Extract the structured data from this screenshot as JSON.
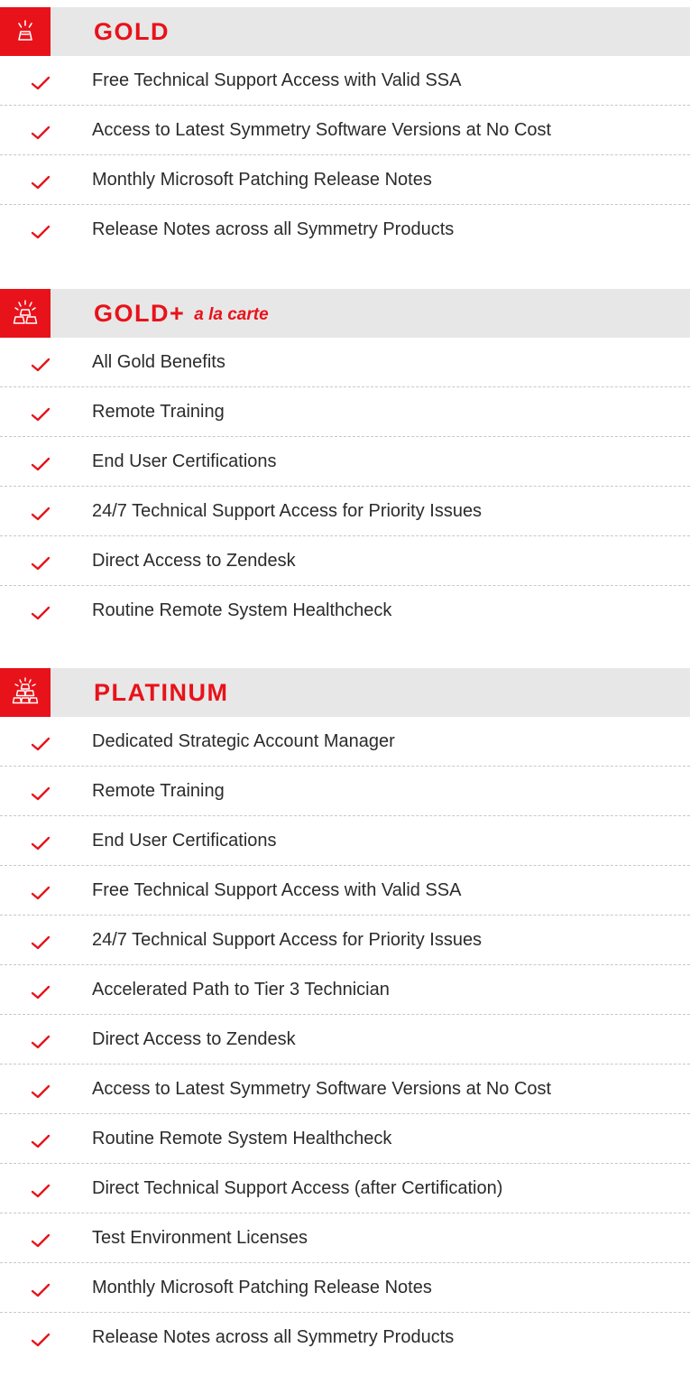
{
  "accent_color": "#e8121a",
  "header_bg": "#e7e7e7",
  "tiers": [
    {
      "name": "GOLD",
      "subtitle": "",
      "icon": "gold-bar-single-icon",
      "features": [
        "Free Technical Support Access with Valid SSA",
        "Access to Latest Symmetry Software Versions at No Cost",
        "Monthly Microsoft Patching Release Notes",
        "Release Notes across all Symmetry Products"
      ]
    },
    {
      "name": "GOLD+",
      "subtitle": "a la carte",
      "icon": "gold-bars-stack-icon",
      "features": [
        "All Gold Benefits",
        "Remote Training",
        "End User Certifications",
        "24/7 Technical Support Access for Priority Issues",
        "Direct Access to Zendesk",
        "Routine Remote System Healthcheck"
      ]
    },
    {
      "name": "PLATINUM",
      "subtitle": "",
      "icon": "platinum-bars-pyramid-icon",
      "features": [
        "Dedicated Strategic Account Manager",
        "Remote Training",
        "End User Certifications",
        "Free Technical Support Access with Valid SSA",
        "24/7 Technical Support Access for Priority Issues",
        "Accelerated Path to Tier 3 Technician",
        "Direct Access to Zendesk",
        "Access to Latest Symmetry Software Versions at No Cost",
        "Routine Remote System Healthcheck",
        "Direct Technical Support Access (after Certification)",
        "Test Environment Licenses",
        "Monthly Microsoft Patching Release Notes",
        "Release Notes across all Symmetry Products"
      ]
    }
  ]
}
